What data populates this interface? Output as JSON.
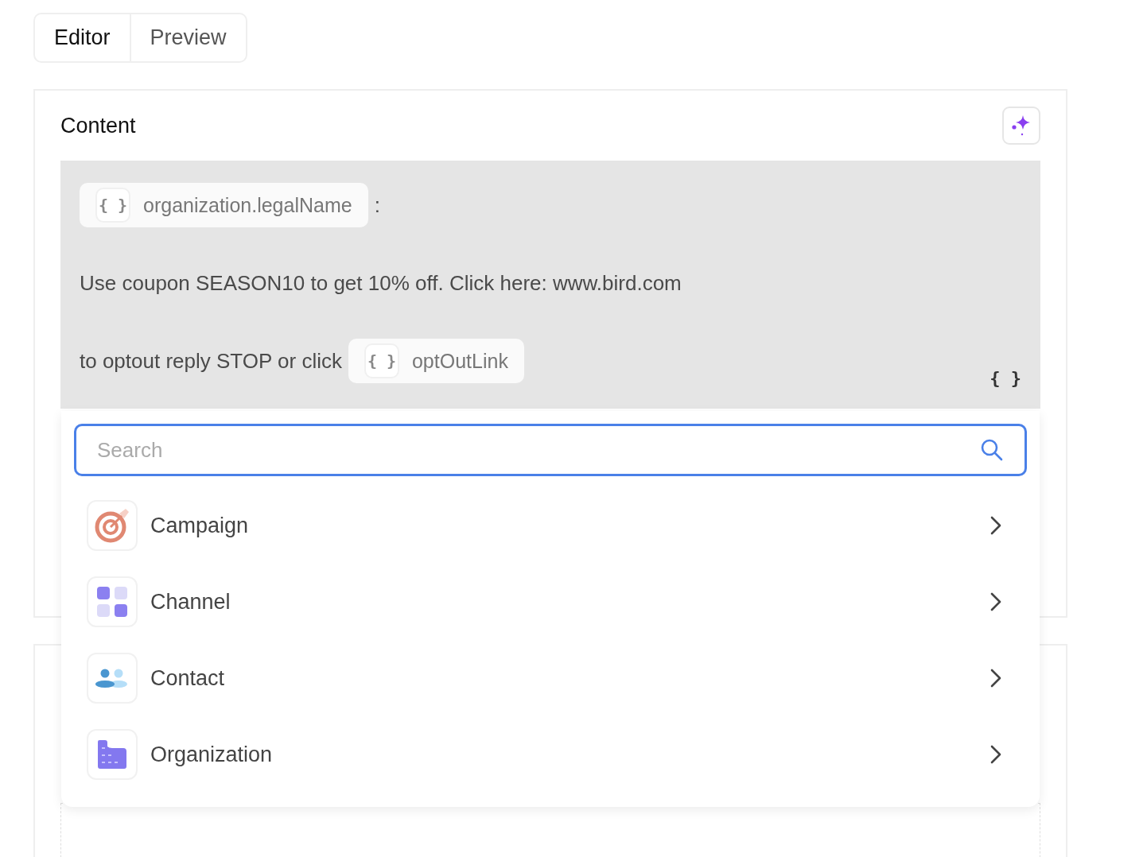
{
  "tabs": [
    {
      "label": "Editor",
      "selected": true
    },
    {
      "label": "Preview",
      "selected": false
    }
  ],
  "content": {
    "title": "Content",
    "paragraphs": [
      {
        "segments": [
          {
            "kind": "variable",
            "text": "organization.legalName",
            "icon": "{ }"
          },
          {
            "kind": "text",
            "text": ":"
          }
        ]
      },
      {
        "segments": [
          {
            "kind": "text",
            "text": "Use coupon SEASON10 to get 10% off. Click here: www.bird.com"
          }
        ]
      },
      {
        "segments": [
          {
            "kind": "text",
            "text": "to optout reply STOP or click"
          },
          {
            "kind": "variable",
            "text": "optOutLink",
            "icon": "{ }"
          }
        ]
      }
    ],
    "insert_variable": "{ }"
  },
  "dropdown": {
    "search": {
      "placeholder": "Search"
    },
    "items": [
      {
        "kind": "campaign",
        "label": "Campaign"
      },
      {
        "kind": "channel",
        "label": "Channel"
      },
      {
        "kind": "contact",
        "label": "Contact"
      },
      {
        "kind": "organization",
        "label": "Organization"
      }
    ]
  }
}
